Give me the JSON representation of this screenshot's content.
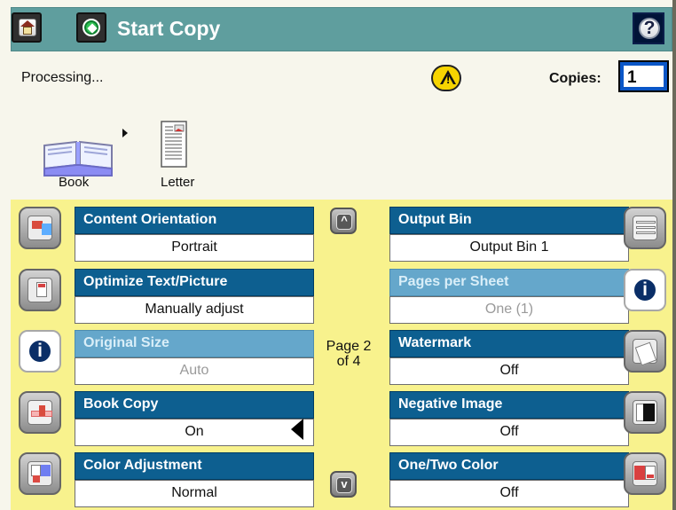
{
  "header": {
    "title": "Start Copy",
    "home_icon": "home-icon",
    "start_icon": "start-icon",
    "help_icon": "question-mark"
  },
  "status": {
    "text": "Processing...",
    "warning_icon": "warning-triangle",
    "copies_label": "Copies:",
    "copies_value": "1"
  },
  "source": {
    "book_label": "Book",
    "letter_label": "Letter"
  },
  "navigation": {
    "page_text": "Page 2\nof 4",
    "up_symbol": "^",
    "down_symbol": "v"
  },
  "settings_left": [
    {
      "title": "Content Orientation",
      "value": "Portrait",
      "enabled": true
    },
    {
      "title": "Optimize Text/Picture",
      "value": "Manually adjust",
      "enabled": true
    },
    {
      "title": "Original Size",
      "value": "Auto",
      "enabled": false
    },
    {
      "title": "Book Copy",
      "value": "On",
      "enabled": true
    },
    {
      "title": "Color Adjustment",
      "value": "Normal",
      "enabled": true
    }
  ],
  "settings_right": [
    {
      "title": "Output Bin",
      "value": "Output Bin 1",
      "enabled": true
    },
    {
      "title": "Pages per Sheet",
      "value": "One (1)",
      "enabled": false
    },
    {
      "title": "Watermark",
      "value": "Off",
      "enabled": true
    },
    {
      "title": "Negative Image",
      "value": "Off",
      "enabled": true
    },
    {
      "title": "One/Two Color",
      "value": "Off",
      "enabled": true
    }
  ]
}
